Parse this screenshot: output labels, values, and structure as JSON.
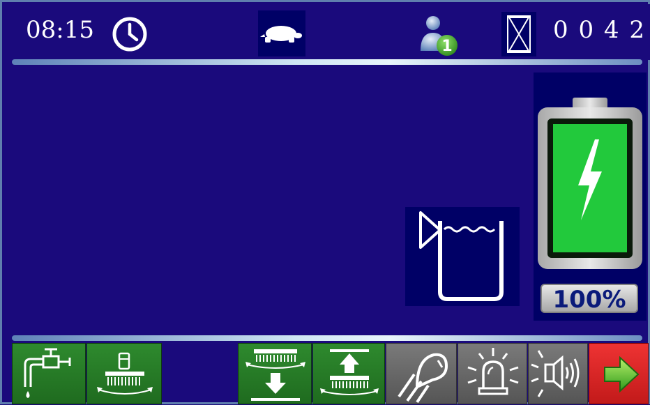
{
  "status_bar": {
    "time": "08:15",
    "clock_icon": "clock-icon",
    "speed_mode_icon": "turtle-icon",
    "user_icon": "user-level-icon",
    "user_level": "1",
    "hour_meter_icon": "hourglass-icon",
    "hour_meter": "0 0 4 2"
  },
  "main": {
    "tank_icon": "water-tank-icon",
    "battery": {
      "icon": "battery-charging-icon",
      "charge_percent_value": 100,
      "label": "100%"
    }
  },
  "toolbar": {
    "buttons": [
      {
        "name": "water-tap-button",
        "icon": "water-tap-icon",
        "color": "#2e8a2e"
      },
      {
        "name": "brush-pressure-button",
        "icon": "brush-pressure-icon",
        "color": "#2e8a2e"
      },
      {
        "name": "brush-down-button",
        "icon": "brush-down-icon",
        "color": "#2e8a2e"
      },
      {
        "name": "brush-up-button",
        "icon": "brush-up-icon",
        "color": "#2e8a2e"
      },
      {
        "name": "work-light-button",
        "icon": "work-light-icon",
        "color": "#666666"
      },
      {
        "name": "beacon-light-button",
        "icon": "beacon-icon",
        "color": "#666666"
      },
      {
        "name": "horn-button",
        "icon": "horn-icon",
        "color": "#666666"
      },
      {
        "name": "next-page-button",
        "icon": "arrow-right-icon",
        "color": "#d62020"
      }
    ]
  },
  "colors": {
    "background": "#1a0a7c",
    "icon_box": "#000066",
    "battery_green": "#22c93c",
    "active_button": "#2e8a2e",
    "inactive_button": "#666666",
    "next_button": "#d62020"
  }
}
